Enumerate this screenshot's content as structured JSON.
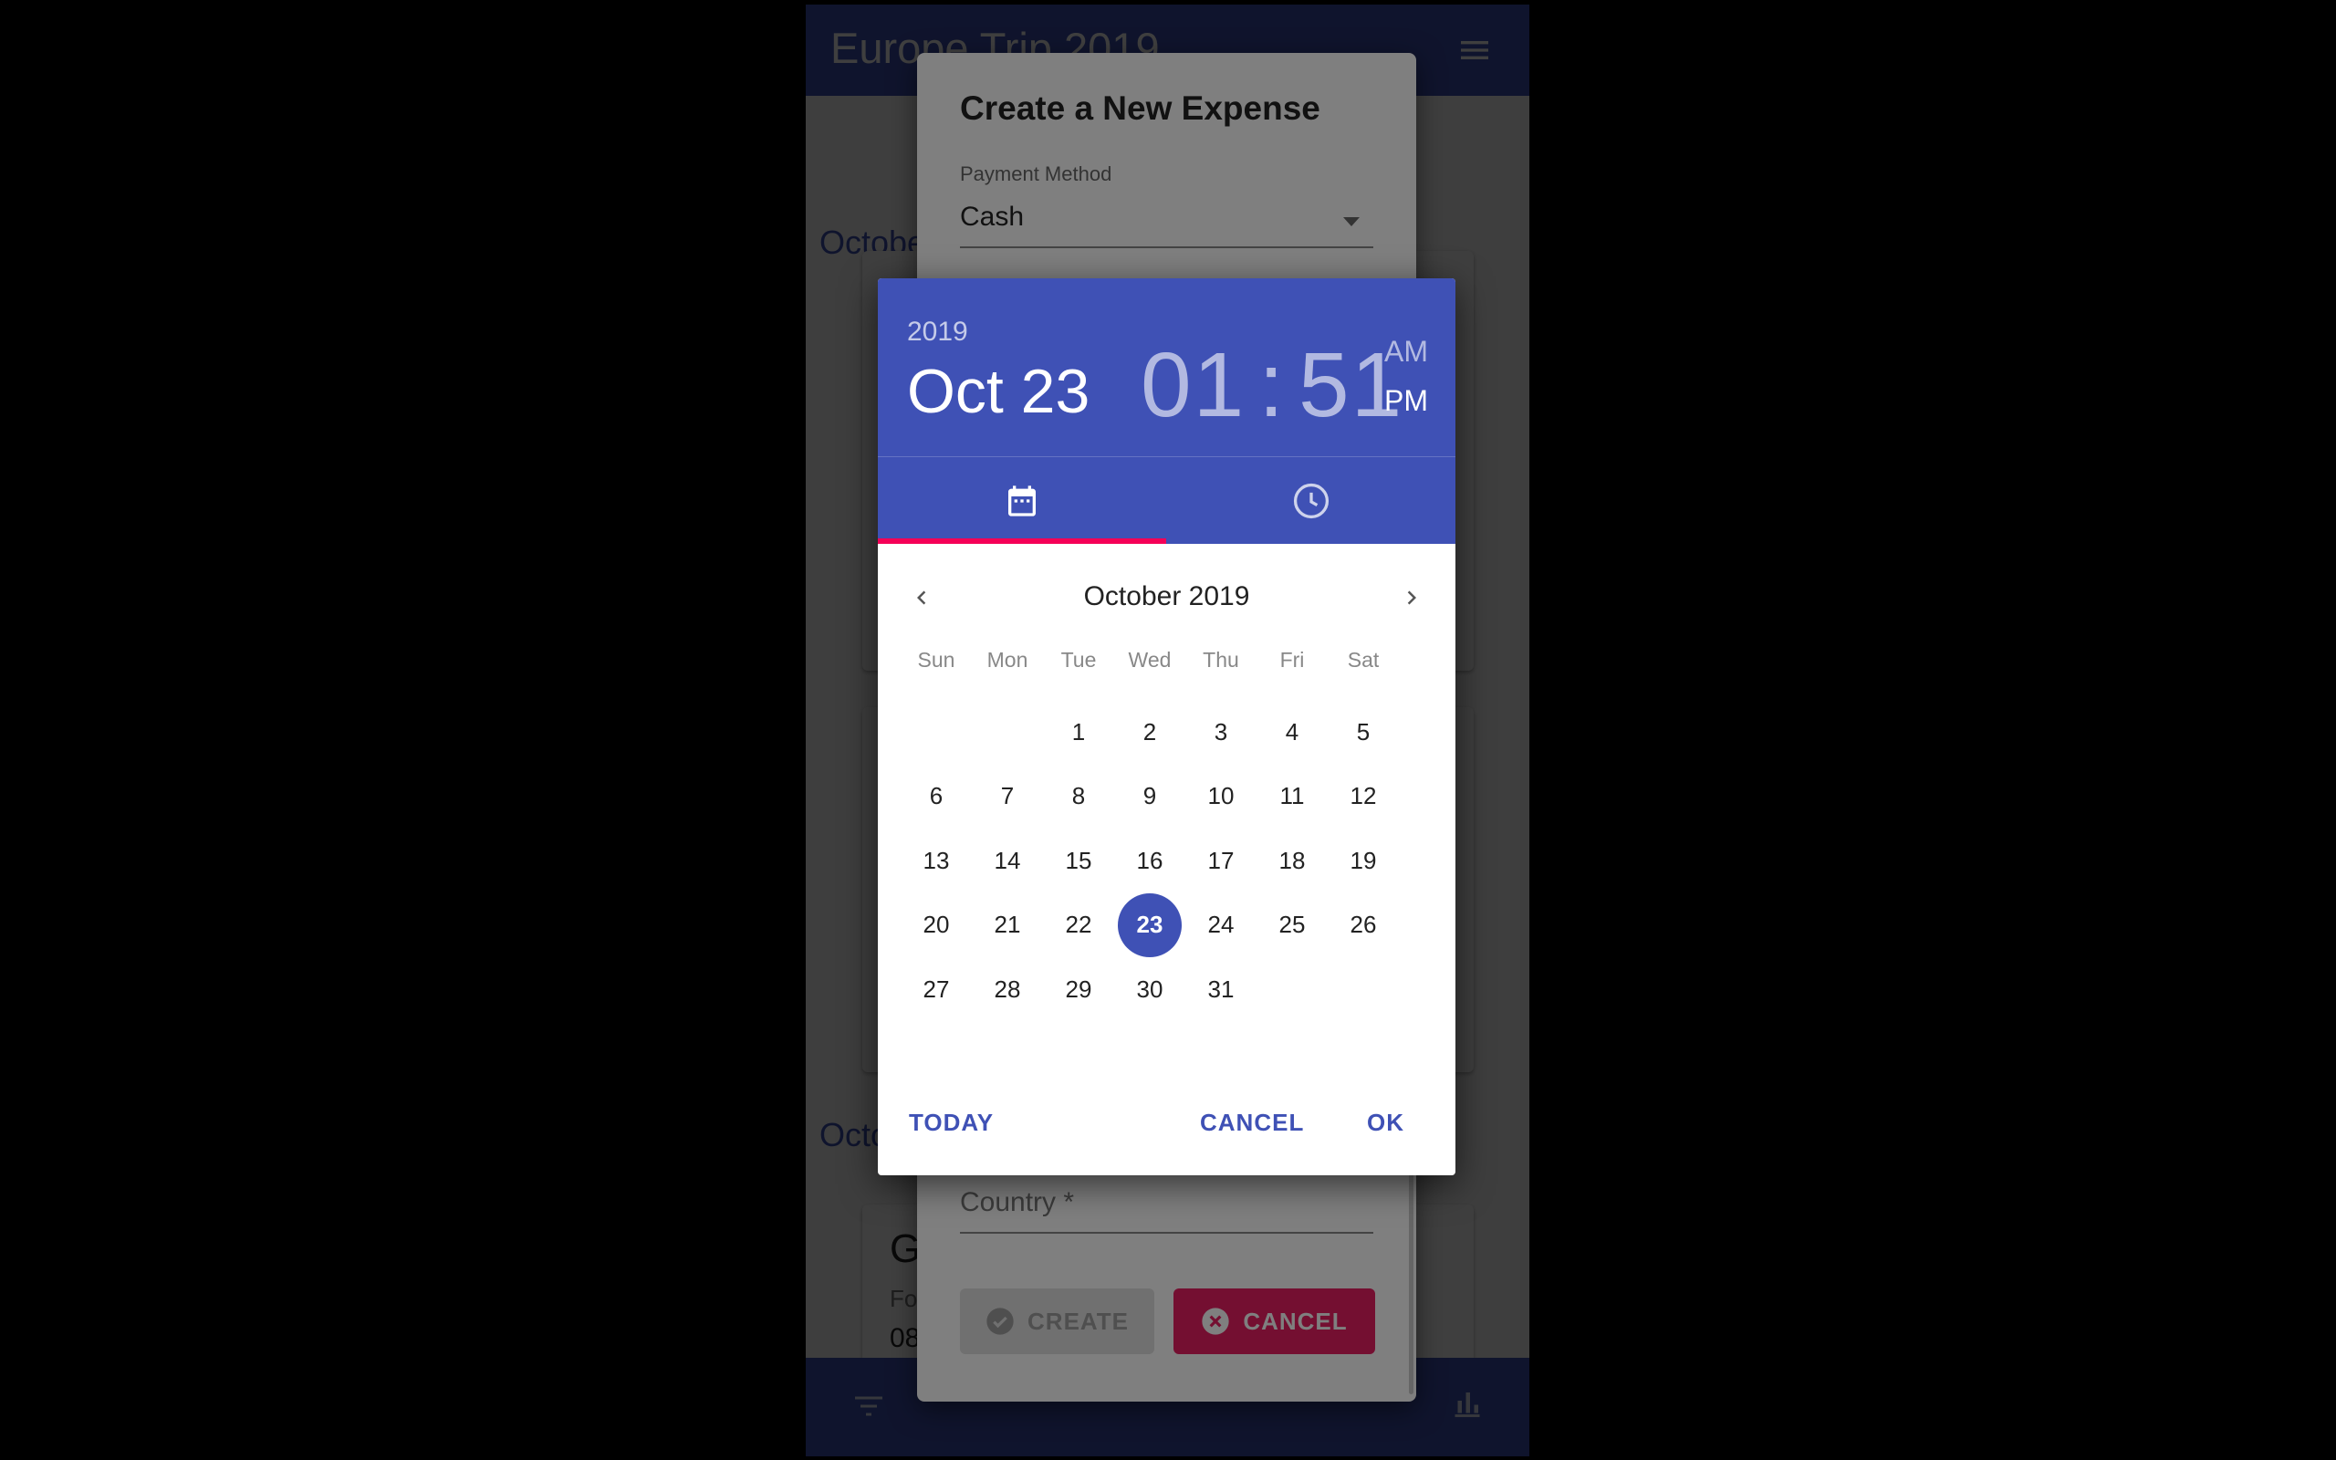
{
  "app": {
    "title": "Europe Trip 2019"
  },
  "background": {
    "section_1": "October",
    "section_2": "October",
    "card": {
      "title": "G",
      "subtitle": "Fo",
      "amount": "08"
    }
  },
  "expense_dialog": {
    "title": "Create a New Expense",
    "payment_label": "Payment Method",
    "payment_value": "Cash",
    "country_placeholder": "Country *",
    "create_label": "CREATE",
    "cancel_label": "CANCEL"
  },
  "picker": {
    "year": "2019",
    "date": "Oct 23",
    "hour": "01",
    "colon": ":",
    "minute": "51",
    "am": "AM",
    "pm": "PM",
    "month_label": "October 2019",
    "weekdays": [
      "Sun",
      "Mon",
      "Tue",
      "Wed",
      "Thu",
      "Fri",
      "Sat"
    ],
    "weeks": [
      [
        "",
        "",
        "1",
        "2",
        "3",
        "4",
        "5"
      ],
      [
        "6",
        "7",
        "8",
        "9",
        "10",
        "11",
        "12"
      ],
      [
        "13",
        "14",
        "15",
        "16",
        "17",
        "18",
        "19"
      ],
      [
        "20",
        "21",
        "22",
        "23",
        "24",
        "25",
        "26"
      ],
      [
        "27",
        "28",
        "29",
        "30",
        "31",
        "",
        ""
      ]
    ],
    "selected_day": "23",
    "today_label": "TODAY",
    "cancel_label": "CANCEL",
    "ok_label": "OK"
  },
  "colors": {
    "primary": "#3f51b5",
    "accent": "#f50057",
    "danger": "#e91e63"
  },
  "icons": [
    "menu-icon",
    "calendar-icon",
    "clock-icon",
    "chevron-left-icon",
    "chevron-right-icon",
    "check-circle-icon",
    "close-circle-icon",
    "filter-icon",
    "bar-chart-icon"
  ]
}
